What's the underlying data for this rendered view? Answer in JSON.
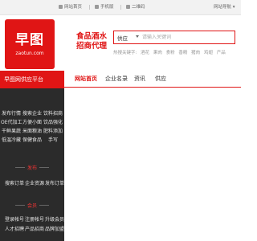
{
  "topbar": {
    "links": [
      "网站首页",
      "手机版",
      "二维码"
    ],
    "login": "网站导航"
  },
  "logo": {
    "name": "早图",
    "url": "zaotun.com"
  },
  "slogan": [
    "食品酒水",
    "招商代理"
  ],
  "search": {
    "category": "供应",
    "placeholder": "请输入关键词"
  },
  "hot": {
    "label": "热搜关键字:",
    "keywords": [
      "酒花",
      "果肉",
      "食粉",
      "香精",
      "猪肉",
      "鸡翅",
      "产品"
    ]
  },
  "nav": {
    "left_title": "早图网供应平台",
    "items": [
      "网站首页",
      "企业名录",
      "资讯",
      "供应"
    ]
  },
  "sidebar": {
    "grid": [
      [
        "发布行情",
        "搜索企业",
        "饮料招商"
      ],
      [
        "OE代加工",
        "方便小面",
        "饮品强化"
      ],
      [
        "干鲜果蔬",
        "米面粮油",
        "肥料添加"
      ],
      [
        "低温冷藏",
        "保健食品",
        "手写"
      ]
    ],
    "sec1_title": "发布",
    "sec1_items": [
      "搜索订单",
      "企业资源",
      "发布订单"
    ],
    "sec2_title": "会员",
    "sec2_items": [
      [
        "登录帐号",
        "注册帐号",
        "升级会员"
      ],
      [
        "人才招聘",
        "产品招商",
        "品牌加盟"
      ]
    ]
  }
}
